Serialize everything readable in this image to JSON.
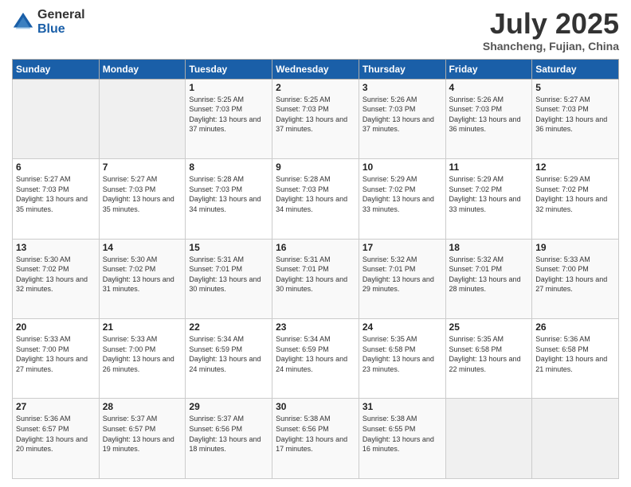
{
  "logo": {
    "general": "General",
    "blue": "Blue"
  },
  "title": "July 2025",
  "location": "Shancheng, Fujian, China",
  "weekdays": [
    "Sunday",
    "Monday",
    "Tuesday",
    "Wednesday",
    "Thursday",
    "Friday",
    "Saturday"
  ],
  "weeks": [
    [
      {
        "day": "",
        "info": ""
      },
      {
        "day": "",
        "info": ""
      },
      {
        "day": "1",
        "info": "Sunrise: 5:25 AM\nSunset: 7:03 PM\nDaylight: 13 hours and 37 minutes."
      },
      {
        "day": "2",
        "info": "Sunrise: 5:25 AM\nSunset: 7:03 PM\nDaylight: 13 hours and 37 minutes."
      },
      {
        "day": "3",
        "info": "Sunrise: 5:26 AM\nSunset: 7:03 PM\nDaylight: 13 hours and 37 minutes."
      },
      {
        "day": "4",
        "info": "Sunrise: 5:26 AM\nSunset: 7:03 PM\nDaylight: 13 hours and 36 minutes."
      },
      {
        "day": "5",
        "info": "Sunrise: 5:27 AM\nSunset: 7:03 PM\nDaylight: 13 hours and 36 minutes."
      }
    ],
    [
      {
        "day": "6",
        "info": "Sunrise: 5:27 AM\nSunset: 7:03 PM\nDaylight: 13 hours and 35 minutes."
      },
      {
        "day": "7",
        "info": "Sunrise: 5:27 AM\nSunset: 7:03 PM\nDaylight: 13 hours and 35 minutes."
      },
      {
        "day": "8",
        "info": "Sunrise: 5:28 AM\nSunset: 7:03 PM\nDaylight: 13 hours and 34 minutes."
      },
      {
        "day": "9",
        "info": "Sunrise: 5:28 AM\nSunset: 7:03 PM\nDaylight: 13 hours and 34 minutes."
      },
      {
        "day": "10",
        "info": "Sunrise: 5:29 AM\nSunset: 7:02 PM\nDaylight: 13 hours and 33 minutes."
      },
      {
        "day": "11",
        "info": "Sunrise: 5:29 AM\nSunset: 7:02 PM\nDaylight: 13 hours and 33 minutes."
      },
      {
        "day": "12",
        "info": "Sunrise: 5:29 AM\nSunset: 7:02 PM\nDaylight: 13 hours and 32 minutes."
      }
    ],
    [
      {
        "day": "13",
        "info": "Sunrise: 5:30 AM\nSunset: 7:02 PM\nDaylight: 13 hours and 32 minutes."
      },
      {
        "day": "14",
        "info": "Sunrise: 5:30 AM\nSunset: 7:02 PM\nDaylight: 13 hours and 31 minutes."
      },
      {
        "day": "15",
        "info": "Sunrise: 5:31 AM\nSunset: 7:01 PM\nDaylight: 13 hours and 30 minutes."
      },
      {
        "day": "16",
        "info": "Sunrise: 5:31 AM\nSunset: 7:01 PM\nDaylight: 13 hours and 30 minutes."
      },
      {
        "day": "17",
        "info": "Sunrise: 5:32 AM\nSunset: 7:01 PM\nDaylight: 13 hours and 29 minutes."
      },
      {
        "day": "18",
        "info": "Sunrise: 5:32 AM\nSunset: 7:01 PM\nDaylight: 13 hours and 28 minutes."
      },
      {
        "day": "19",
        "info": "Sunrise: 5:33 AM\nSunset: 7:00 PM\nDaylight: 13 hours and 27 minutes."
      }
    ],
    [
      {
        "day": "20",
        "info": "Sunrise: 5:33 AM\nSunset: 7:00 PM\nDaylight: 13 hours and 27 minutes."
      },
      {
        "day": "21",
        "info": "Sunrise: 5:33 AM\nSunset: 7:00 PM\nDaylight: 13 hours and 26 minutes."
      },
      {
        "day": "22",
        "info": "Sunrise: 5:34 AM\nSunset: 6:59 PM\nDaylight: 13 hours and 24 minutes."
      },
      {
        "day": "23",
        "info": "Sunrise: 5:34 AM\nSunset: 6:59 PM\nDaylight: 13 hours and 24 minutes."
      },
      {
        "day": "24",
        "info": "Sunrise: 5:35 AM\nSunset: 6:58 PM\nDaylight: 13 hours and 23 minutes."
      },
      {
        "day": "25",
        "info": "Sunrise: 5:35 AM\nSunset: 6:58 PM\nDaylight: 13 hours and 22 minutes."
      },
      {
        "day": "26",
        "info": "Sunrise: 5:36 AM\nSunset: 6:58 PM\nDaylight: 13 hours and 21 minutes."
      }
    ],
    [
      {
        "day": "27",
        "info": "Sunrise: 5:36 AM\nSunset: 6:57 PM\nDaylight: 13 hours and 20 minutes."
      },
      {
        "day": "28",
        "info": "Sunrise: 5:37 AM\nSunset: 6:57 PM\nDaylight: 13 hours and 19 minutes."
      },
      {
        "day": "29",
        "info": "Sunrise: 5:37 AM\nSunset: 6:56 PM\nDaylight: 13 hours and 18 minutes."
      },
      {
        "day": "30",
        "info": "Sunrise: 5:38 AM\nSunset: 6:56 PM\nDaylight: 13 hours and 17 minutes."
      },
      {
        "day": "31",
        "info": "Sunrise: 5:38 AM\nSunset: 6:55 PM\nDaylight: 13 hours and 16 minutes."
      },
      {
        "day": "",
        "info": ""
      },
      {
        "day": "",
        "info": ""
      }
    ]
  ]
}
